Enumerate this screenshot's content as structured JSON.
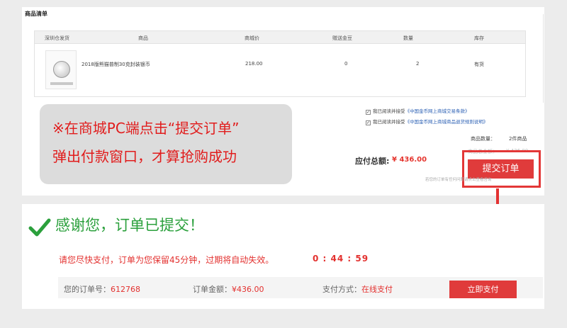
{
  "order_page": {
    "list_title": "商品清单",
    "seller": "深圳仓发货",
    "columns": [
      "商品",
      "商城价",
      "赠送金豆",
      "数量",
      "库存"
    ],
    "item": {
      "name": "2018版熊猫普制30克封装银币",
      "price": "218.00",
      "gold_beans": "0",
      "quantity": "2",
      "stock": "有货"
    },
    "agreements": [
      {
        "prefix": "我已阅读并接受",
        "link": "《中国金币网上商城交易条款》"
      },
      {
        "prefix": "我已阅读并接受",
        "link": "《中国金币网上商城商品退货规则说明》"
      }
    ],
    "summary": {
      "count_label": "商品数量：",
      "count_value": "2件商品",
      "amount_label": "商品总金额：",
      "amount_value": "¥ 436.00"
    },
    "total_label": "应付总额:",
    "total_value": "¥ 436.00",
    "submit_label": "提交订单",
    "small_tip": "若您的订单有任何问题请点击查看咨询"
  },
  "callout": {
    "line1": "※在商城PC端点击“提交订单”",
    "line2": "弹出付款窗口，才算抢购成功"
  },
  "confirmation": {
    "thanks": "感谢您，订单已提交！",
    "notice": "请您尽快支付，订单为您保留45分钟，过期将自动失效。",
    "countdown": "0 : 44 : 59",
    "order_no_label": "您的订单号：",
    "order_no": "612768",
    "amount_label": "订单金额：",
    "amount": "¥436.00",
    "pay_method_label": "支付方式：",
    "pay_method": "在线支付",
    "pay_button": "立即支付"
  },
  "colors": {
    "accent_red": "#e03b3b",
    "success_green": "#2ba03c",
    "link_blue": "#2e62b5"
  },
  "icons": [
    "check-icon",
    "down-arrow-icon",
    "checkbox-icon",
    "coin-thumbnail"
  ]
}
